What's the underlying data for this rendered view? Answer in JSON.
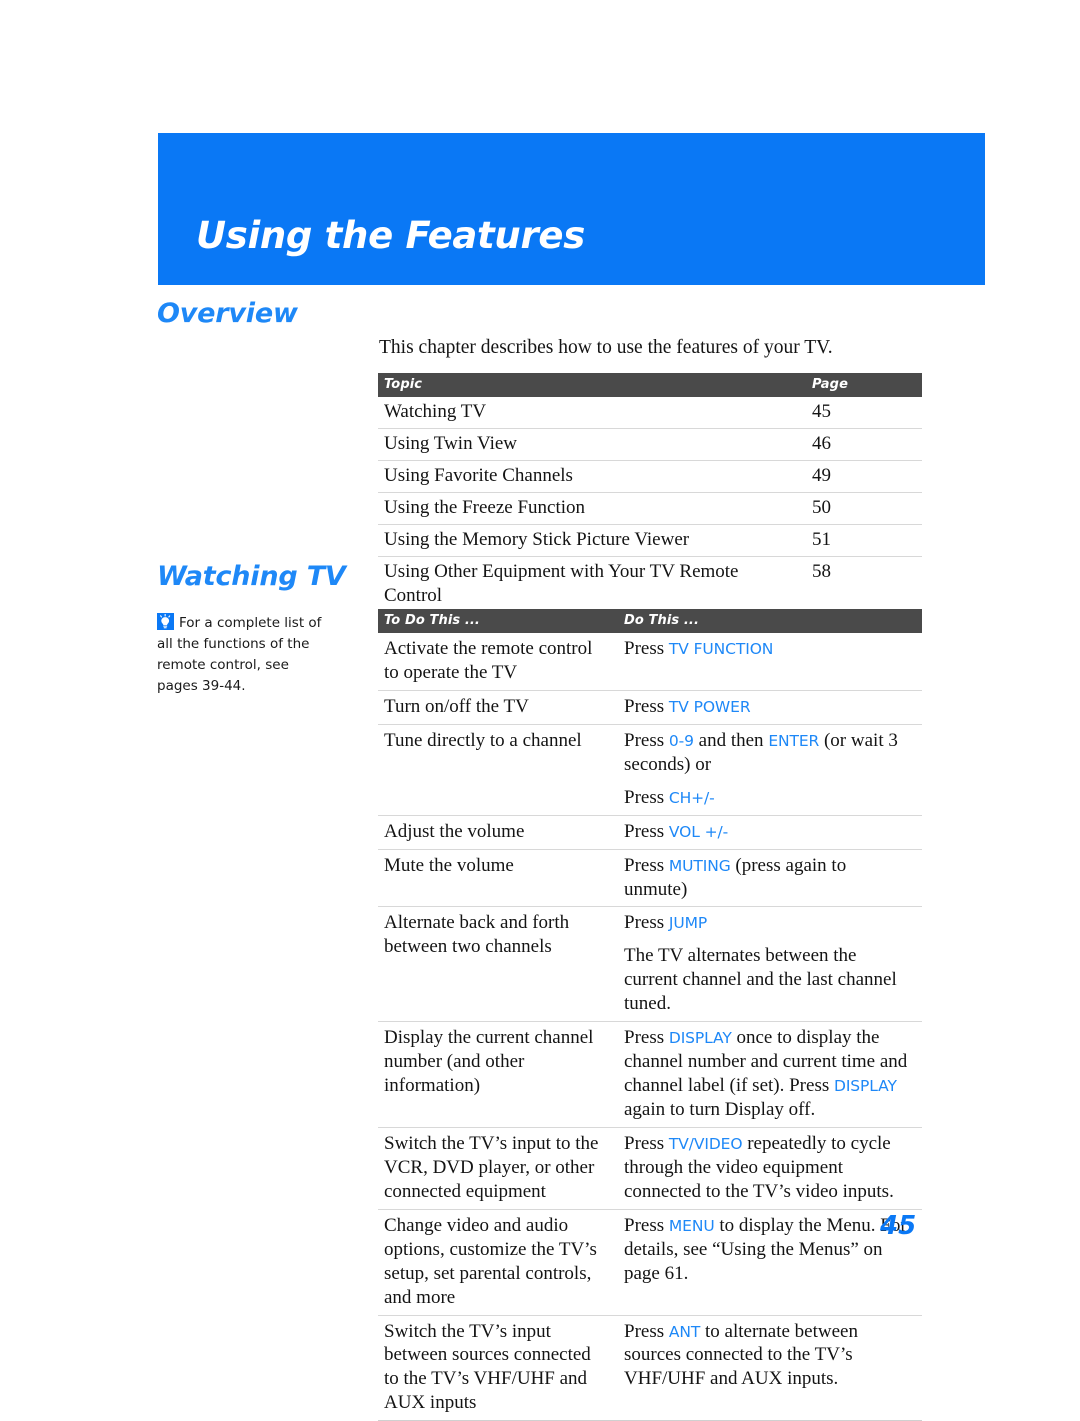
{
  "chapter": {
    "banner_title": "Using the Features",
    "banner_color": "#0a78f5"
  },
  "overview": {
    "heading": "Overview",
    "intro": "This chapter describes how to use the features of your TV.",
    "toc": {
      "headers": [
        "Topic",
        "Page"
      ],
      "rows": [
        {
          "topic": "Watching TV",
          "page": "45"
        },
        {
          "topic": "Using Twin View",
          "page": "46"
        },
        {
          "topic": "Using Favorite Channels",
          "page": "49"
        },
        {
          "topic": "Using the Freeze Function",
          "page": "50"
        },
        {
          "topic": "Using the Memory Stick Picture Viewer",
          "page": "51"
        },
        {
          "topic": "Using Other Equipment with Your TV Remote Control",
          "page": "58"
        }
      ]
    }
  },
  "watching_tv": {
    "heading": "Watching TV",
    "tip": {
      "icon": "lightbulb-icon",
      "text": "For a complete list of all the functions of the remote control, see pages 39-44."
    },
    "table": {
      "headers": [
        "To Do This ...",
        "Do This ..."
      ],
      "rows": [
        {
          "todo": "Activate the remote control to operate the TV",
          "do_parts": [
            [
              {
                "t": "Press ",
                "kw": false
              },
              {
                "t": "TV FUNCTION",
                "kw": true
              }
            ]
          ]
        },
        {
          "todo": "Turn on/off the TV",
          "do_parts": [
            [
              {
                "t": "Press ",
                "kw": false
              },
              {
                "t": "TV POWER",
                "kw": true
              }
            ]
          ]
        },
        {
          "todo": "Tune directly to a channel",
          "do_parts": [
            [
              {
                "t": "Press ",
                "kw": false
              },
              {
                "t": "0-9",
                "kw": true
              },
              {
                "t": " and then ",
                "kw": false
              },
              {
                "t": "ENTER",
                "kw": true
              },
              {
                "t": " (or wait 3 seconds) or",
                "kw": false
              }
            ],
            [
              {
                "t": "Press ",
                "kw": false
              },
              {
                "t": "CH+/-",
                "kw": true
              }
            ]
          ]
        },
        {
          "todo": "Adjust the volume",
          "do_parts": [
            [
              {
                "t": "Press ",
                "kw": false
              },
              {
                "t": "VOL +/-",
                "kw": true
              }
            ]
          ]
        },
        {
          "todo": "Mute the volume",
          "do_parts": [
            [
              {
                "t": "Press ",
                "kw": false
              },
              {
                "t": "MUTING",
                "kw": true
              },
              {
                "t": " (press again to unmute)",
                "kw": false
              }
            ]
          ]
        },
        {
          "todo": "Alternate back and forth between two channels",
          "do_parts": [
            [
              {
                "t": "Press ",
                "kw": false
              },
              {
                "t": "JUMP",
                "kw": true
              }
            ],
            [
              {
                "t": "The TV alternates between the current channel and the last channel tuned.",
                "kw": false
              }
            ]
          ]
        },
        {
          "todo": "Display the current channel number (and other information)",
          "do_parts": [
            [
              {
                "t": "Press ",
                "kw": false
              },
              {
                "t": "DISPLAY",
                "kw": true
              },
              {
                "t": " once to display the channel number and current time and channel label (if set). Press ",
                "kw": false
              },
              {
                "t": "DISPLAY",
                "kw": true
              },
              {
                "t": " again to turn Display off.",
                "kw": false
              }
            ]
          ]
        },
        {
          "todo": "Switch the TV’s input to the VCR, DVD player, or other connected equipment",
          "do_parts": [
            [
              {
                "t": "Press ",
                "kw": false
              },
              {
                "t": "TV/VIDEO",
                "kw": true
              },
              {
                "t": " repeatedly to cycle through the video equipment connected to the TV’s video inputs.",
                "kw": false
              }
            ]
          ]
        },
        {
          "todo": "Change video and audio options, customize the TV’s setup, set parental controls, and more",
          "do_parts": [
            [
              {
                "t": "Press ",
                "kw": false
              },
              {
                "t": "MENU",
                "kw": true
              },
              {
                "t": " to display the Menu. For details, see “Using the Menus” on page 61.",
                "kw": false
              }
            ]
          ]
        },
        {
          "todo": "Switch the TV’s input between sources connected to the TV’s VHF/UHF and AUX inputs",
          "do_parts": [
            [
              {
                "t": "Press ",
                "kw": false
              },
              {
                "t": "ANT",
                "kw": true
              },
              {
                "t": " to alternate between sources connected to the TV’s VHF/UHF and AUX inputs.",
                "kw": false
              }
            ]
          ]
        }
      ]
    }
  },
  "footer": {
    "page_number": "45"
  }
}
